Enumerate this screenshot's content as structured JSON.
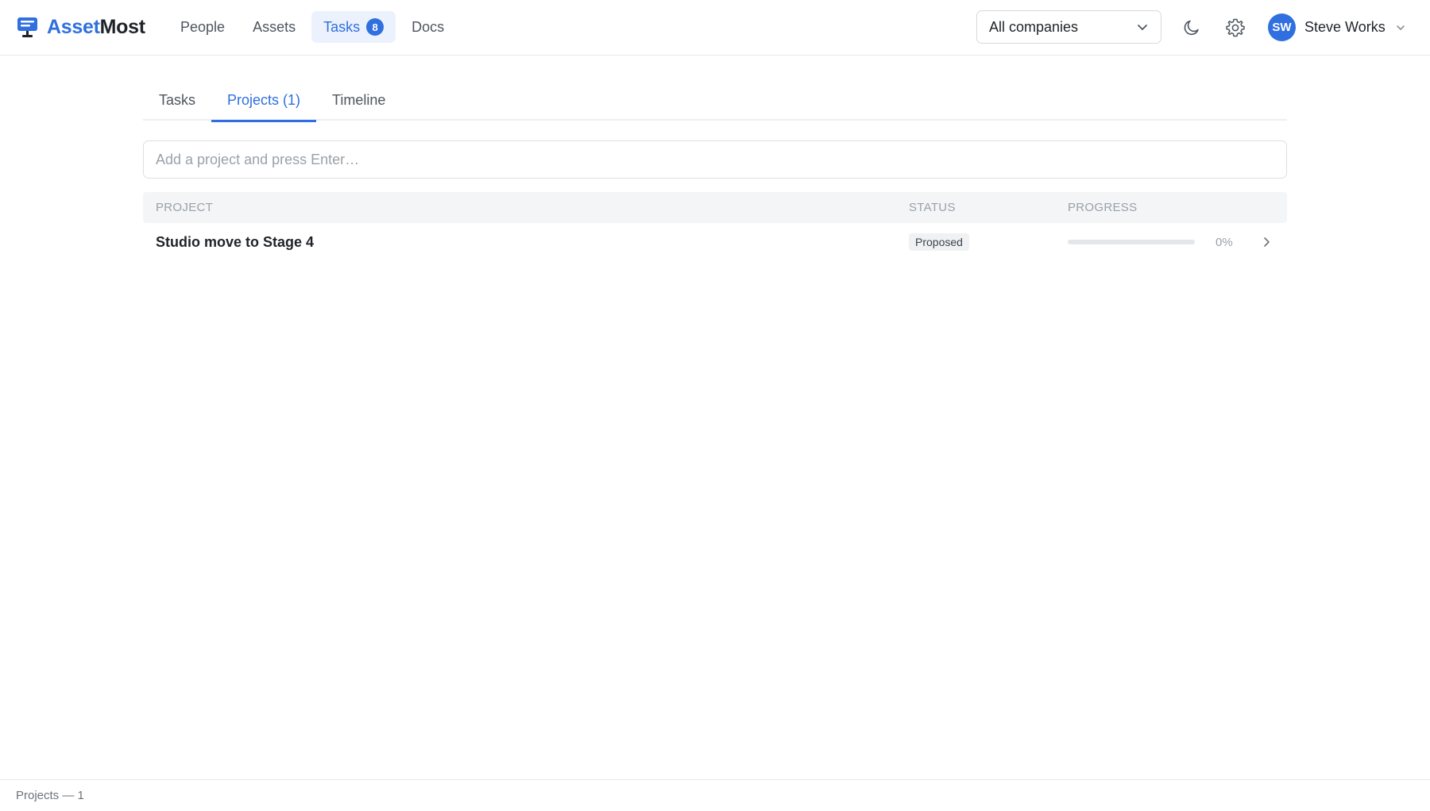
{
  "app": {
    "logo_part1": "Asset",
    "logo_part2": "Most",
    "logo_icon": "monitor-icon"
  },
  "nav": {
    "items": [
      {
        "label": "People"
      },
      {
        "label": "Assets"
      },
      {
        "label": "Tasks",
        "badge": "8",
        "active": true
      },
      {
        "label": "Docs"
      }
    ]
  },
  "company_select": {
    "value": "All companies"
  },
  "header_icons": [
    "moon-icon",
    "gear-icon"
  ],
  "user": {
    "initials": "SW",
    "name": "Steve Works"
  },
  "tabs": [
    {
      "label": "Tasks"
    },
    {
      "label": "Projects (1)",
      "active": true
    },
    {
      "label": "Timeline"
    }
  ],
  "add_project": {
    "placeholder": "Add a project and press Enter…"
  },
  "table": {
    "headers": {
      "project": "PROJECT",
      "status": "STATUS",
      "progress": "PROGRESS"
    },
    "rows": [
      {
        "project": "Studio move to Stage 4",
        "status": "Proposed",
        "progress_label": "0%",
        "progress": 0
      }
    ]
  },
  "footer": {
    "text": "Projects — 1"
  },
  "colors": {
    "accent": "#2f6fe0",
    "text": "#1f2329",
    "muted": "#9aa1a9"
  }
}
